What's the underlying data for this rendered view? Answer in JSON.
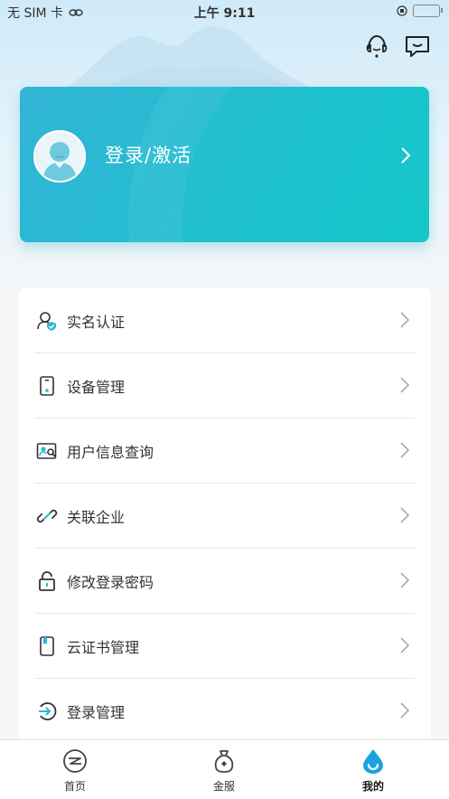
{
  "status_bar": {
    "carrier": "无 SIM 卡",
    "time": "上午 9:11"
  },
  "header": {
    "icons": [
      "customer-service-icon",
      "message-icon"
    ]
  },
  "login_card": {
    "label": "登录/激活",
    "avatar_icon": "user-avatar-icon"
  },
  "menu": {
    "items": [
      {
        "label": "实名认证",
        "icon": "verified-user-icon"
      },
      {
        "label": "设备管理",
        "icon": "phone-device-icon"
      },
      {
        "label": "用户信息查询",
        "icon": "id-card-search-icon"
      },
      {
        "label": "关联企业",
        "icon": "link-icon"
      },
      {
        "label": "修改登录密码",
        "icon": "lock-icon"
      },
      {
        "label": "云证书管理",
        "icon": "certificate-icon"
      },
      {
        "label": "登录管理",
        "icon": "login-icon"
      }
    ]
  },
  "tabbar": {
    "tabs": [
      {
        "label": "首页",
        "icon": "home-logo-icon"
      },
      {
        "label": "金服",
        "icon": "money-bag-icon"
      },
      {
        "label": "我的",
        "icon": "water-drop-icon",
        "active": true
      }
    ]
  },
  "colors": {
    "accent": "#1fc1cf",
    "active_tab": "#1aa3e0"
  }
}
